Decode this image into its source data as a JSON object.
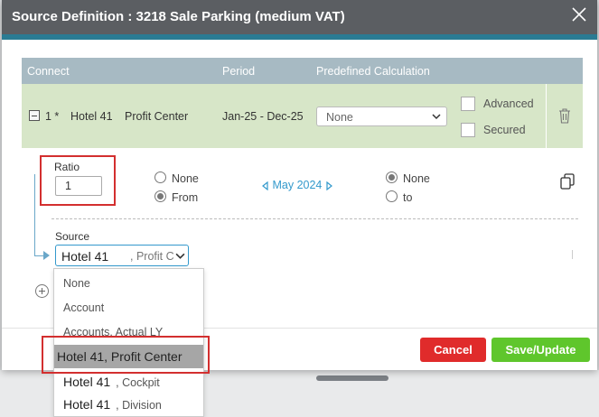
{
  "dialog": {
    "title": "Source Definition : 3218 Sale Parking (medium VAT)"
  },
  "table": {
    "headers": [
      "Connect",
      "Period",
      "Predefined Calculation"
    ],
    "row": {
      "index": "1 *",
      "hotel": "Hotel 41",
      "division": "Profit Center",
      "period": "Jan-25 - Dec-25",
      "calculation": "None",
      "advanced_label": "Advanced",
      "secured_label": "Secured"
    }
  },
  "ratio": {
    "label": "Ratio",
    "value": "1"
  },
  "from_options": {
    "none_label": "None",
    "from_label": "From",
    "selected": "From"
  },
  "period_nav": {
    "label": "May 2024"
  },
  "to_options": {
    "none_label": "None",
    "to_label": "to",
    "selected": "None"
  },
  "source": {
    "label": "Source",
    "value_main": "Hotel 41",
    "value_rest": ", Profit C",
    "dropdown": [
      {
        "text": "None"
      },
      {
        "text": "Account"
      },
      {
        "text": "Accounts, Actual LY"
      },
      {
        "text": "Hotel 41, Profit Center"
      },
      {
        "prefix": "Hotel 41",
        "suffix": ", Cockpit"
      },
      {
        "prefix": "Hotel 41",
        "suffix": ", Division"
      }
    ],
    "selected_index": 3
  },
  "buttons": {
    "cancel": "Cancel",
    "save": "Save/Update"
  },
  "colors": {
    "titlebar": "#5b5e62",
    "accent": "#2a7b93",
    "header": "#a7bac3",
    "row": "#d7e6c8",
    "cancel": "#e02b2b",
    "save": "#5fc62c",
    "highlight": "#d32f2f",
    "link": "#3399cc"
  }
}
